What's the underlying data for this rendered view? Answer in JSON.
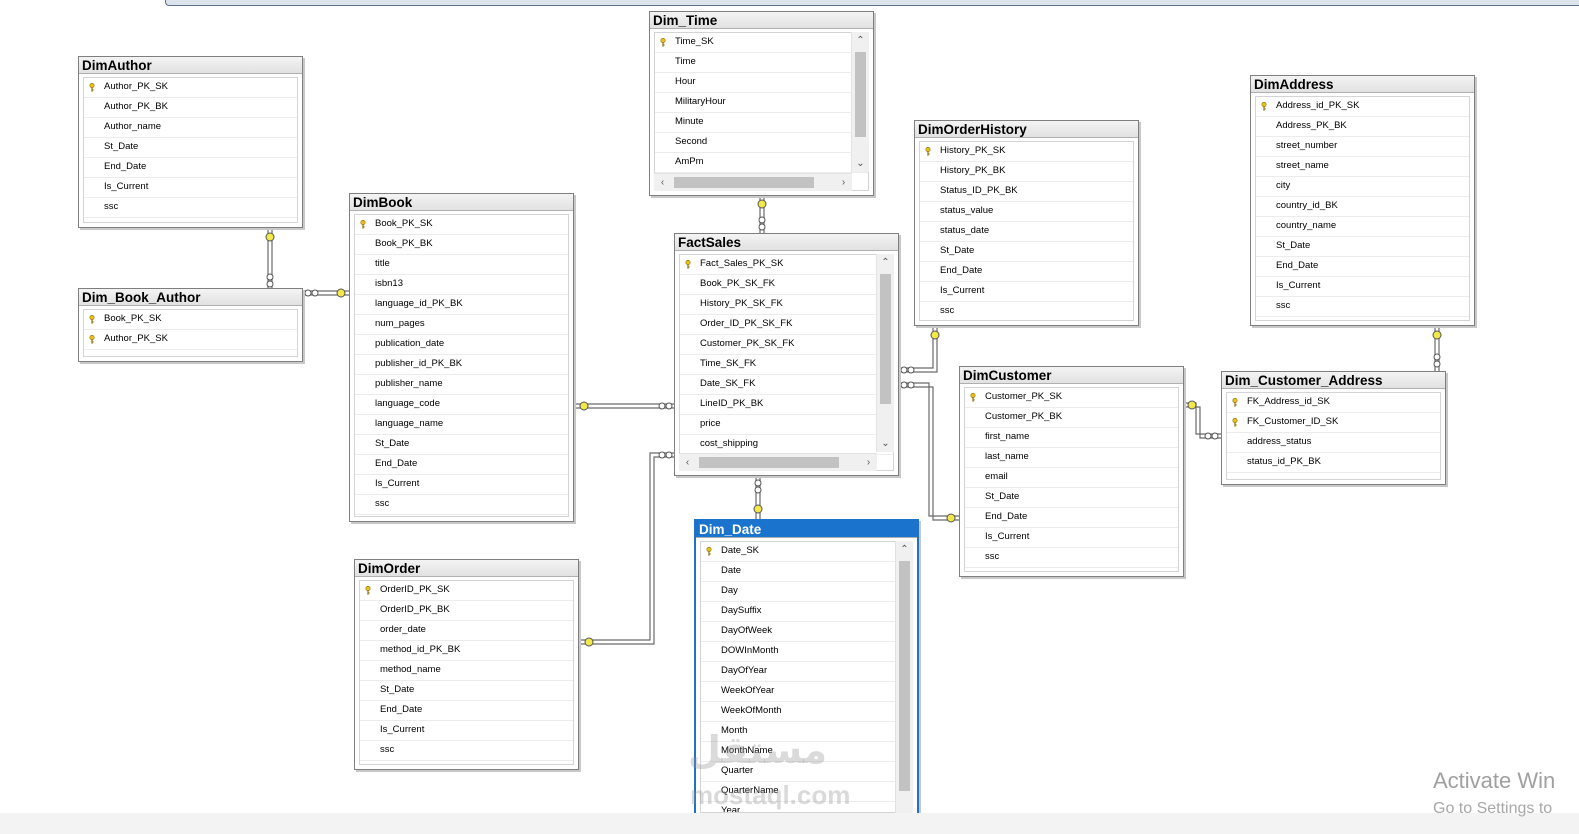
{
  "tables": {
    "dim_author": {
      "name": "DimAuthor",
      "columns": [
        "Author_PK_SK",
        "Author_PK_BK",
        "Author_name",
        "St_Date",
        "End_Date",
        "Is_Current",
        "ssc"
      ]
    },
    "dim_book_author": {
      "name": "Dim_Book_Author",
      "columns": [
        "Book_PK_SK",
        "Author_PK_SK"
      ]
    },
    "dim_book": {
      "name": "DimBook",
      "columns": [
        "Book_PK_SK",
        "Book_PK_BK",
        "title",
        "isbn13",
        "language_id_PK_BK",
        "num_pages",
        "publication_date",
        "publisher_id_PK_BK",
        "publisher_name",
        "language_code",
        "language_name",
        "St_Date",
        "End_Date",
        "Is_Current",
        "ssc"
      ]
    },
    "dim_order": {
      "name": "DimOrder",
      "columns": [
        "OrderID_PK_SK",
        "OrderID_PK_BK",
        "order_date",
        "method_id_PK_BK",
        "method_name",
        "St_Date",
        "End_Date",
        "Is_Current",
        "ssc"
      ]
    },
    "dim_time": {
      "name": "Dim_Time",
      "columns": [
        "Time_SK",
        "Time",
        "Hour",
        "MilitaryHour",
        "Minute",
        "Second",
        "AmPm"
      ]
    },
    "fact_sales": {
      "name": "FactSales",
      "columns": [
        "Fact_Sales_PK_SK",
        "Book_PK_SK_FK",
        "History_PK_SK_FK",
        "Order_ID_PK_SK_FK",
        "Customer_PK_SK_FK",
        "Time_SK_FK",
        "Date_SK_FK",
        "LineID_PK_BK",
        "price",
        "cost_shipping"
      ]
    },
    "dim_date": {
      "name": "Dim_Date",
      "columns": [
        "Date_SK",
        "Date",
        "Day",
        "DaySuffix",
        "DayOfWeek",
        "DOWInMonth",
        "DayOfYear",
        "WeekOfYear",
        "WeekOfMonth",
        "Month",
        "MonthName",
        "Quarter",
        "QuarterName",
        "Year"
      ]
    },
    "dim_order_history": {
      "name": "DimOrderHistory",
      "columns": [
        "History_PK_SK",
        "History_PK_BK",
        "Status_ID_PK_BK",
        "status_value",
        "status_date",
        "St_Date",
        "End_Date",
        "Is_Current",
        "ssc"
      ]
    },
    "dim_customer": {
      "name": "DimCustomer",
      "columns": [
        "Customer_PK_SK",
        "Customer_PK_BK",
        "first_name",
        "last_name",
        "email",
        "St_Date",
        "End_Date",
        "Is_Current",
        "ssc"
      ]
    },
    "dim_address": {
      "name": "DimAddress",
      "columns": [
        "Address_id_PK_SK",
        "Address_PK_BK",
        "street_number",
        "street_name",
        "city",
        "country_id_BK",
        "country_name",
        "St_Date",
        "End_Date",
        "Is_Current",
        "ssc"
      ]
    },
    "dim_customer_address": {
      "name": "Dim_Customer_Address",
      "columns": [
        "FK_Address_id_SK",
        "FK_Customer_ID_SK",
        "address_status",
        "status_id_PK_BK"
      ]
    }
  },
  "watermark": {
    "arabic": "مستقل",
    "latin": "mostaql.com"
  },
  "os_notice": {
    "title": "Activate Win",
    "subtitle": "Go to Settings to"
  },
  "colors": {
    "selected_header": "#1a73cc",
    "key_icon": "#e8c21a",
    "connector": "#707070"
  }
}
